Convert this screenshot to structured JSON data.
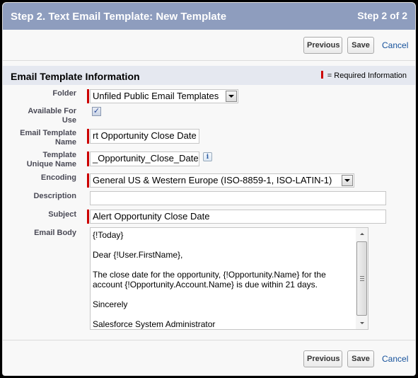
{
  "header": {
    "title": "Step 2. Text Email Template: New Template",
    "step": "Step 2 of 2"
  },
  "buttons": {
    "previous": "Previous",
    "save": "Save",
    "cancel": "Cancel"
  },
  "section": {
    "title": "Email Template Information",
    "required_legend": "= Required Information"
  },
  "form": {
    "folder": {
      "label": "Folder",
      "value": "Unfiled Public Email Templates",
      "required": true
    },
    "available_for_use": {
      "label_line1": "Available For",
      "label_line2": "Use",
      "checked": true,
      "check_glyph": "✓"
    },
    "template_name": {
      "label_line1": "Email Template",
      "label_line2": "Name",
      "value": "rt Opportunity Close Date",
      "required": true
    },
    "unique_name": {
      "label_line1": "Template",
      "label_line2": "Unique Name",
      "value": "_Opportunity_Close_Date",
      "required": true,
      "info_glyph": "i"
    },
    "encoding": {
      "label": "Encoding",
      "value": "General US & Western Europe (ISO-8859-1, ISO-LATIN-1)",
      "required": true
    },
    "description": {
      "label": "Description",
      "value": ""
    },
    "subject": {
      "label": "Subject",
      "value": "Alert Opportunity Close Date",
      "required": true
    },
    "email_body": {
      "label": "Email Body",
      "value": "{!Today}\n\nDear {!User.FirstName},\n\nThe close date for the opportunity, {!Opportunity.Name} for the account {!Opportunity.Account.Name} is due within 21 days.\n\nSincerely\n\nSalesforce System Administrator"
    }
  },
  "colors": {
    "header_bg": "#8e9dbe",
    "section_bg": "#e5e8f0",
    "required_bar": "#cc0000",
    "link": "#15519b"
  }
}
